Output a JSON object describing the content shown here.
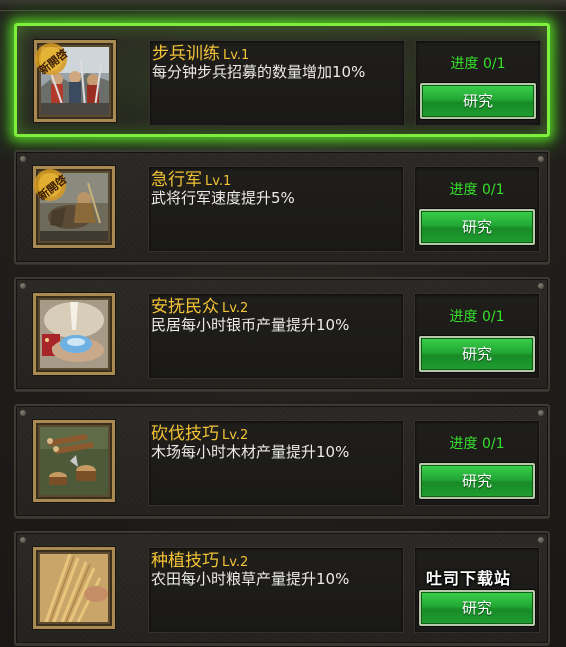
{
  "skills": [
    {
      "name": "步兵训练",
      "level": "Lv.1",
      "description": "每分钟步兵招募的数量增加10%",
      "progress": "进度 0/1",
      "button_label": "研究",
      "is_new": true,
      "highlighted": true,
      "icon": "infantry-soldiers-icon"
    },
    {
      "name": "急行军",
      "level": "Lv.1",
      "description": "武将行军速度提升5%",
      "progress": "进度 0/1",
      "button_label": "研究",
      "is_new": true,
      "highlighted": false,
      "icon": "cavalry-march-icon"
    },
    {
      "name": "安抚民众",
      "level": "Lv.2",
      "description": "民居每小时银币产量提升10%",
      "progress": "进度 0/1",
      "button_label": "研究",
      "is_new": false,
      "highlighted": false,
      "icon": "silver-ingot-icon"
    },
    {
      "name": "砍伐技巧",
      "level": "Lv.2",
      "description": "木场每小时木材产量提升10%",
      "progress": "进度 0/1",
      "button_label": "研究",
      "is_new": false,
      "highlighted": false,
      "icon": "logging-stumps-icon"
    },
    {
      "name": "种植技巧",
      "level": "Lv.2",
      "description": "农田每小时粮草产量提升10%",
      "progress": "",
      "button_label": "研究",
      "is_new": false,
      "highlighted": false,
      "icon": "wheat-harvest-icon"
    }
  ],
  "new_badge_text": "新開啓",
  "watermark": "吐司下载站",
  "colors": {
    "name_gold": "#f3c335",
    "progress_green": "#35e02a",
    "button_green": "#22a834",
    "highlight_glow": "#7cf03a"
  }
}
